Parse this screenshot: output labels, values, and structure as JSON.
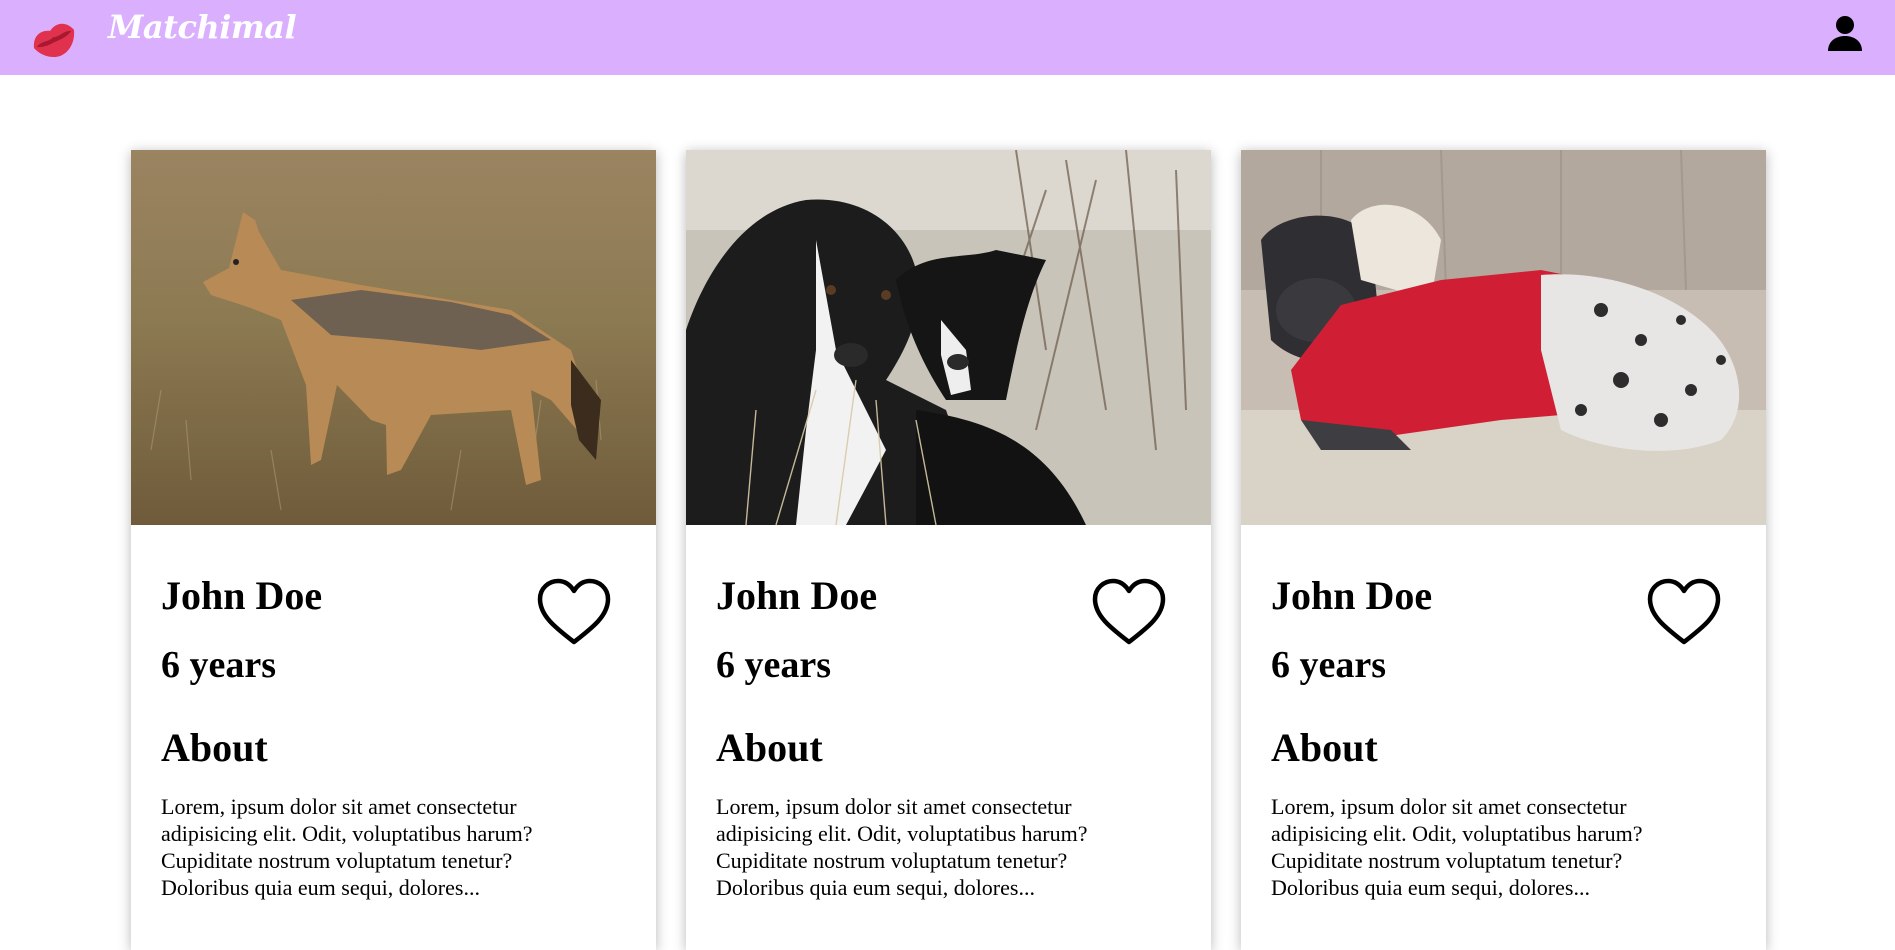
{
  "app": {
    "brand_name": "Matchimal",
    "logo_icon": "lips-kiss-icon",
    "profile_icon": "user-silhouette-icon",
    "colors": {
      "navbar_bg": "#dab0fe",
      "logo_red": "#e0324f",
      "text": "#000000"
    }
  },
  "cards": [
    {
      "photo_subject": "jackal standing in grass",
      "name": "John Doe",
      "age": "6 years",
      "about_heading": "About",
      "about_text": "Lorem, ipsum dolor sit amet consectetur adipisicing elit. Odit, voluptatibus harum? Cupiditate nostrum voluptatum tenetur? Doloribus quia eum sequi, dolores...",
      "like_icon": "heart-outline-icon"
    },
    {
      "photo_subject": "two black and white border collies in dune grass",
      "name": "John Doe",
      "age": "6 years",
      "about_heading": "About",
      "about_text": "Lorem, ipsum dolor sit amet consectetur adipisicing elit. Odit, voluptatibus harum? Cupiditate nostrum voluptatum tenetur? Doloribus quia eum sequi, dolores...",
      "like_icon": "heart-outline-icon"
    },
    {
      "photo_subject": "dog in red hoodie lying on couch",
      "name": "John Doe",
      "age": "6 years",
      "about_heading": "About",
      "about_text": "Lorem, ipsum dolor sit amet consectetur adipisicing elit. Odit, voluptatibus harum? Cupiditate nostrum voluptatum tenetur? Doloribus quia eum sequi, dolores...",
      "like_icon": "heart-outline-icon"
    }
  ]
}
